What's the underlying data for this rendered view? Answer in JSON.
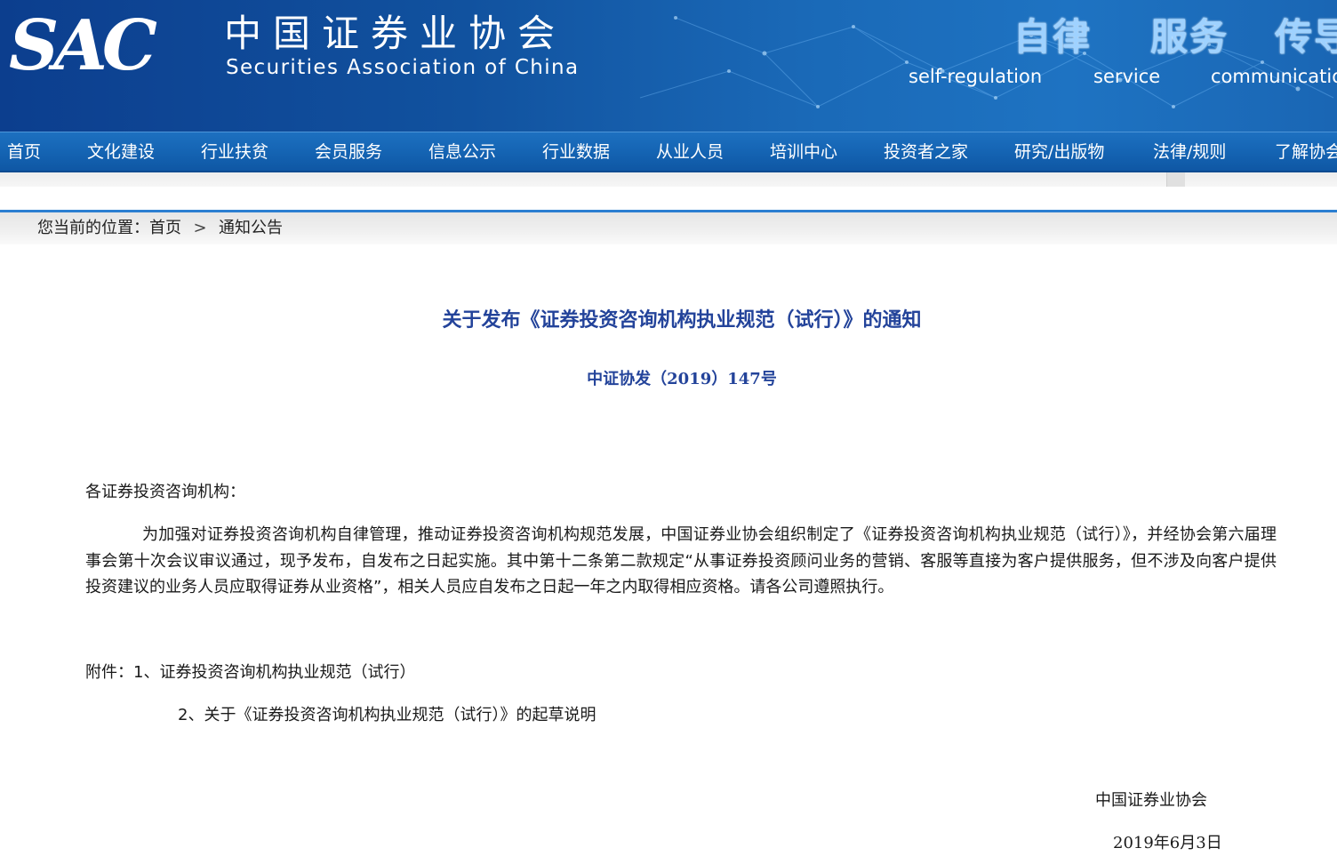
{
  "header": {
    "logo_abbr": "SAC",
    "logo_cn": "中国证券业协会",
    "logo_en": "Securities Association of China",
    "slogans": [
      {
        "zh": "自律",
        "en": "self-regulation"
      },
      {
        "zh": "服务",
        "en": "service"
      },
      {
        "zh": "传导",
        "en": "communication"
      }
    ]
  },
  "nav": {
    "items": [
      "首页",
      "文化建设",
      "行业扶贫",
      "会员服务",
      "信息公示",
      "行业数据",
      "从业人员",
      "培训中心",
      "投资者之家",
      "研究/出版物",
      "法律/规则",
      "了解协会"
    ]
  },
  "breadcrumb": {
    "prefix": "您当前的位置：首页",
    "separator": ">",
    "current": "通知公告"
  },
  "article": {
    "title": "关于发布《证券投资咨询机构执业规范（试行）》的通知",
    "doc_number": "中证协发（2019）147号",
    "addressee": "各证券投资咨询机构：",
    "body": "为加强对证券投资咨询机构自律管理，推动证券投资咨询机构规范发展，中国证券业协会组织制定了《证券投资咨询机构执业规范（试行）》，并经协会第六届理事会第十次会议审议通过，现予发布，自发布之日起实施。其中第十二条第二款规定“从事证券投资顾问业务的营销、客服等直接为客户提供服务，但不涉及向客户提供投资建议的业务人员应取得证券从业资格”，相关人员应自发布之日起一年之内取得相应资格。请各公司遵照执行。",
    "attachment_1": "附件：1、证券投资咨询机构执业规范（试行）",
    "attachment_2": "2、关于《证券投资咨询机构执业规范（试行）》的起草说明",
    "signature_org": "中国证券业协会",
    "signature_date": "2019年6月3日"
  }
}
